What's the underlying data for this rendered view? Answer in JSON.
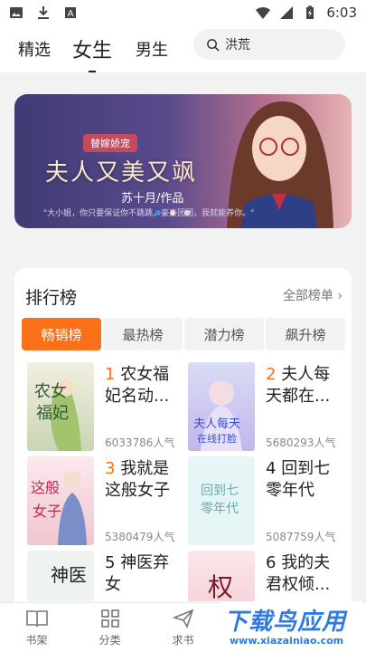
{
  "status_bar": {
    "time": "6:03"
  },
  "header": {
    "tabs": [
      "精选",
      "女生",
      "男生"
    ],
    "active_tab": "女生",
    "search": {
      "value": "洪荒"
    }
  },
  "banner": {
    "tagline": "替嫁娇宠",
    "title": "夫人又美又飒",
    "author": "苏十月/作品",
    "quote": "\"大小姐，你只要保证你不跳跳，豪豪团团，我就能养你。\""
  },
  "ranking": {
    "title": "排行榜",
    "all_label": "全部榜单",
    "tabs": [
      "畅销榜",
      "最热榜",
      "潜力榜",
      "飙升榜"
    ],
    "active_tab": "畅销榜",
    "items": [
      {
        "rank": "1",
        "title": "农女福妃名动...",
        "popularity": "6033786人气",
        "cover_text": "农女福妃"
      },
      {
        "rank": "2",
        "title": "夫人每天都在...",
        "popularity": "5680293人气",
        "cover_text": "夫人每天在线打脸"
      },
      {
        "rank": "3",
        "title": "我就是这般女子",
        "popularity": "5380479人气",
        "cover_text": "这般女子"
      },
      {
        "rank": "4",
        "title": "回到七零年代",
        "popularity": "5087759人气",
        "cover_text": "回到七零年代"
      },
      {
        "rank": "5",
        "title": "神医弃女",
        "popularity": "",
        "cover_text": "神医弃女"
      },
      {
        "rank": "6",
        "title": "我的夫君权倾...",
        "popularity": "",
        "cover_text": "权"
      }
    ]
  },
  "bottom_nav": [
    "书架",
    "分类",
    "求书",
    "我的"
  ],
  "watermark": {
    "title": "下载鸟应用",
    "url": "www.xiazainiao.com"
  },
  "colors": {
    "accent": "#fb7018",
    "dot_active": "#3a8df2"
  }
}
